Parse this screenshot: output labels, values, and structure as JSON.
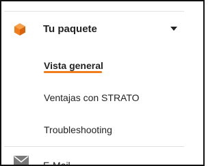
{
  "colors": {
    "accent": "#f07c1a",
    "text": "#222222",
    "muted_icon": "#7a7a7a",
    "divider": "#e2e2e2"
  },
  "section": {
    "icon": "package-icon",
    "label": "Tu paquete",
    "expanded": true,
    "toggle_icon": "caret-down-icon"
  },
  "items": [
    {
      "label": "Vista general",
      "active": true
    },
    {
      "label": "Ventajas con STRATO",
      "active": false
    },
    {
      "label": "Troubleshooting",
      "active": false
    }
  ],
  "next_section": {
    "icon": "mail-icon",
    "label": "E-Mail"
  }
}
